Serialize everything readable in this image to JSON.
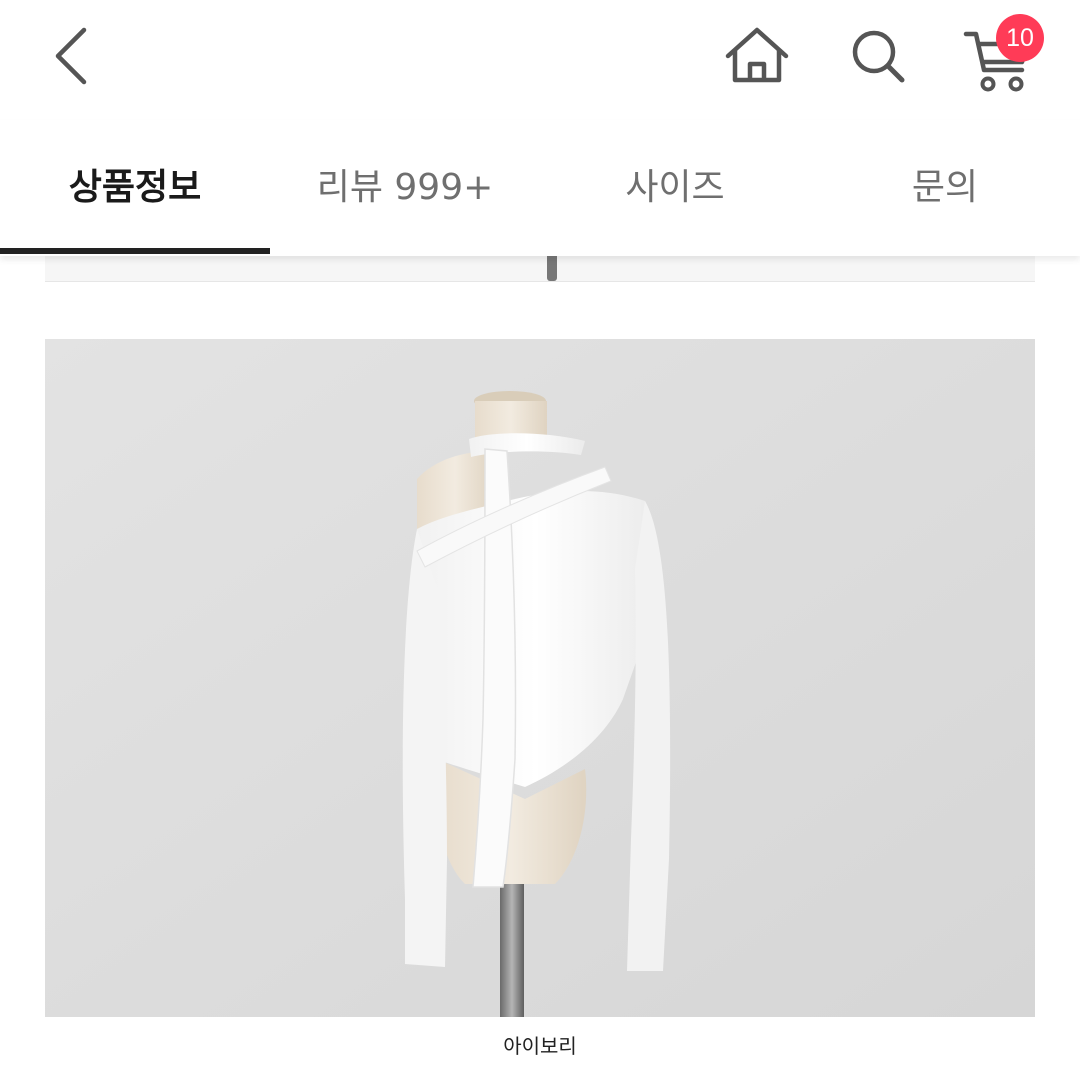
{
  "header": {
    "back_icon": "chevron-left-icon",
    "home_icon": "home-icon",
    "search_icon": "search-icon",
    "cart_icon": "cart-icon",
    "cart_count": "10",
    "badge_color": "#ff3b57"
  },
  "tabs": [
    {
      "label": "상품정보",
      "active": true
    },
    {
      "label": "리뷰 999+",
      "active": false
    },
    {
      "label": "사이즈",
      "active": false
    },
    {
      "label": "문의",
      "active": false
    }
  ],
  "product": {
    "color_caption": "아이보리"
  }
}
